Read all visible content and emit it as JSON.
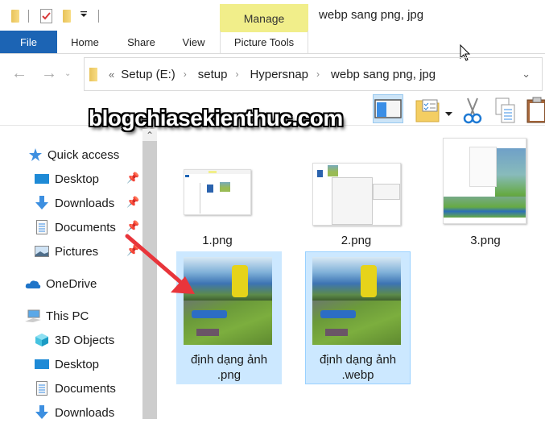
{
  "window": {
    "title": "webp sang png, jpg",
    "contextual_tab_group": "Manage",
    "quick_access_toolbar": [
      "folder-icon",
      "properties-checkmark-icon",
      "new-folder-icon",
      "customize-dropdown-icon"
    ]
  },
  "ribbon": {
    "tabs": [
      {
        "label": "File",
        "active": true
      },
      {
        "label": "Home"
      },
      {
        "label": "Share"
      },
      {
        "label": "View"
      },
      {
        "label": "Picture Tools"
      }
    ]
  },
  "address_bar": {
    "overflow": "«",
    "breadcrumbs": [
      "Setup (E:)",
      "setup",
      "Hypersnap",
      "webp sang png, jpg"
    ]
  },
  "watermark": "blogchiasekienthuc.com",
  "nav_pane": {
    "quick_access": {
      "label": "Quick access",
      "items": [
        {
          "label": "Desktop",
          "pinned": true
        },
        {
          "label": "Downloads",
          "pinned": true
        },
        {
          "label": "Documents",
          "pinned": true
        },
        {
          "label": "Pictures",
          "pinned": true
        }
      ]
    },
    "onedrive": {
      "label": "OneDrive"
    },
    "this_pc": {
      "label": "This PC",
      "items": [
        {
          "label": "3D Objects"
        },
        {
          "label": "Desktop"
        },
        {
          "label": "Documents"
        },
        {
          "label": "Downloads"
        }
      ]
    }
  },
  "files": [
    {
      "name": "1.png",
      "selected": false
    },
    {
      "name": "2.png",
      "selected": false
    },
    {
      "name": "3.png",
      "selected": false
    },
    {
      "name_line1": "định dạng ảnh",
      "name_line2": ".png",
      "selected": true
    },
    {
      "name_line1": "định dạng ảnh",
      "name_line2": ".webp",
      "selected": true,
      "focused": true
    }
  ],
  "colors": {
    "file_tab": "#1c64b4",
    "manage_tab": "#f1ee8a",
    "selection": "#cce8ff",
    "annotation_arrow": "#e8353b"
  }
}
